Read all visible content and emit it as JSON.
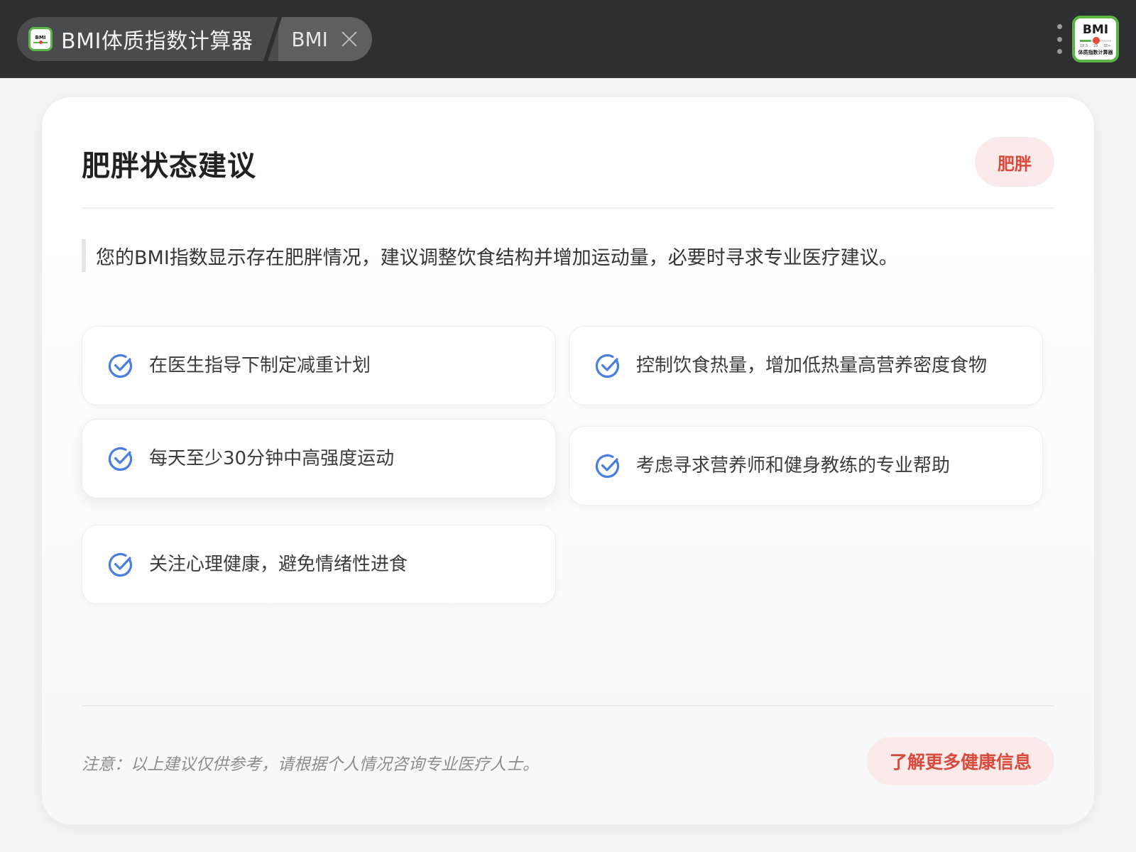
{
  "tab": {
    "logo_text": "BMI",
    "title": "BMI体质指数计算器",
    "sub_label": "BMI"
  },
  "app_icon": {
    "title": "BMI",
    "ticks": [
      "18.5",
      "25",
      "30+"
    ],
    "caption": "体质指数计算器"
  },
  "card": {
    "title": "肥胖状态建议",
    "badge": "肥胖",
    "summary": "您的BMI指数显示存在肥胖情况，建议调整饮食结构并增加运动量，必要时寻求专业医疗建议。",
    "tips": [
      "在医生指导下制定减重计划",
      "控制饮食热量，增加低热量高营养密度食物",
      "每天至少30分钟中高强度运动",
      "考虑寻求营养师和健身教练的专业帮助",
      "关注心理健康，避免情绪性进食"
    ],
    "disclaimer": "注意：以上建议仅供参考，请根据个人情况咨询专业医疗人士。",
    "more_button": "了解更多健康信息"
  },
  "colors": {
    "accent_red": "#d94b3c",
    "badge_bg": "#fbeaea",
    "check_blue": "#4a7fe0",
    "brand_green": "#5bb546"
  },
  "icons": {
    "tip": "check-circle-icon",
    "close": "close-icon",
    "menu": "more-vertical-icon"
  }
}
